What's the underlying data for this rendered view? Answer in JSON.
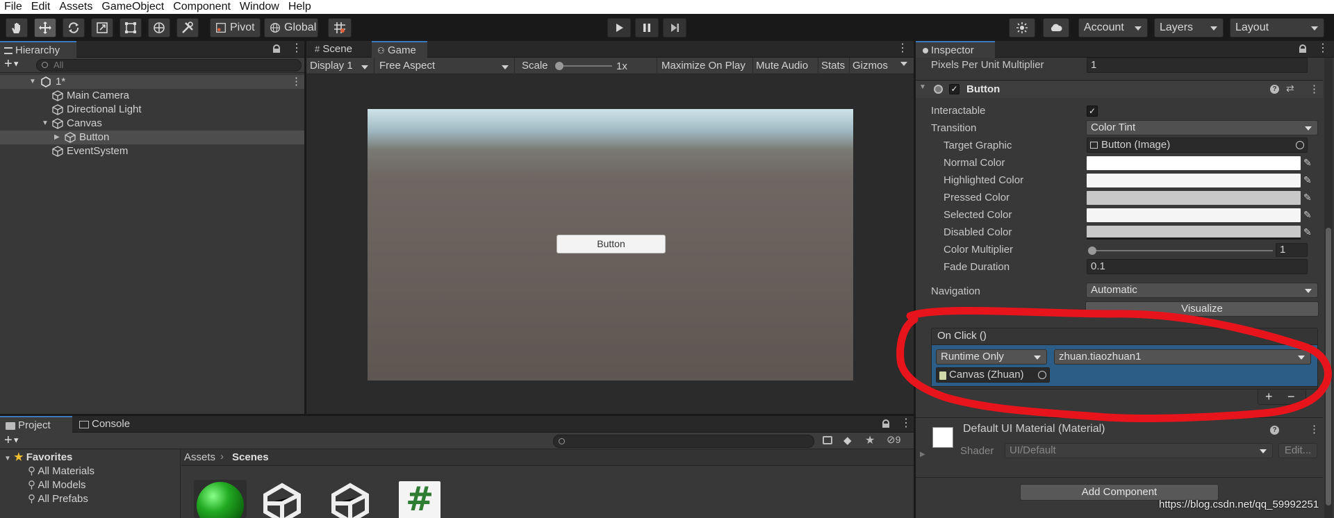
{
  "menu": [
    "File",
    "Edit",
    "Assets",
    "GameObject",
    "Component",
    "Window",
    "Help"
  ],
  "toolbar": {
    "pivot": "Pivot",
    "global": "Global",
    "account": "Account",
    "layers": "Layers",
    "layout": "Layout"
  },
  "hierarchy": {
    "tab": "Hierarchy",
    "search_placeholder": "All",
    "scene": "1*",
    "items": [
      {
        "label": "Main Camera"
      },
      {
        "label": "Directional Light"
      },
      {
        "label": "Canvas"
      },
      {
        "label": "Button"
      },
      {
        "label": "EventSystem"
      }
    ]
  },
  "game": {
    "tabs": [
      "Scene",
      "Game"
    ],
    "display": "Display 1",
    "aspect": "Free Aspect",
    "scale_label": "Scale",
    "scale_value": "1x",
    "options": [
      "Maximize On Play",
      "Mute Audio",
      "Stats",
      "Gizmos"
    ],
    "button_label": "Button"
  },
  "project": {
    "tabs": [
      "Project",
      "Console"
    ],
    "favorites": "Favorites",
    "fav_items": [
      "All Materials",
      "All Models",
      "All Prefabs"
    ],
    "breadcrumb": [
      "Assets",
      "Scenes"
    ],
    "hidden_count": "9",
    "asset_hash": "#"
  },
  "inspector": {
    "tab": "Inspector",
    "pixels_label": "Pixels Per Unit Multiplier",
    "pixels_value": "1",
    "component": "Button",
    "interactable_label": "Interactable",
    "transition_label": "Transition",
    "transition_value": "Color Tint",
    "target_graphic_label": "Target Graphic",
    "target_graphic_value": "Button (Image)",
    "normal_label": "Normal Color",
    "highlighted_label": "Highlighted Color",
    "pressed_label": "Pressed Color",
    "selected_label": "Selected Color",
    "disabled_label": "Disabled Color",
    "multiplier_label": "Color Multiplier",
    "multiplier_value": "1",
    "fade_label": "Fade Duration",
    "fade_value": "0.1",
    "navigation_label": "Navigation",
    "navigation_value": "Automatic",
    "visualize": "Visualize",
    "onclick_header": "On Click ()",
    "runtime": "Runtime Only",
    "function": "zhuan.tiaozhuan1",
    "object": "Canvas (Zhuan)",
    "plus": "+",
    "minus": "−",
    "material_name": "Default UI Material (Material)",
    "shader_label": "Shader",
    "shader_value": "UI/Default",
    "edit": "Edit...",
    "add_component": "Add Component"
  },
  "colors": {
    "normal": "#ffffff",
    "highlighted": "#f5f5f5",
    "pressed": "#c8c8c8",
    "selected": "#f5f5f5",
    "disabled": "#c8c8c8",
    "annotation": "#e8141c",
    "selection": "#2c5d87"
  },
  "watermark": "https://blog.csdn.net/qq_59992251"
}
